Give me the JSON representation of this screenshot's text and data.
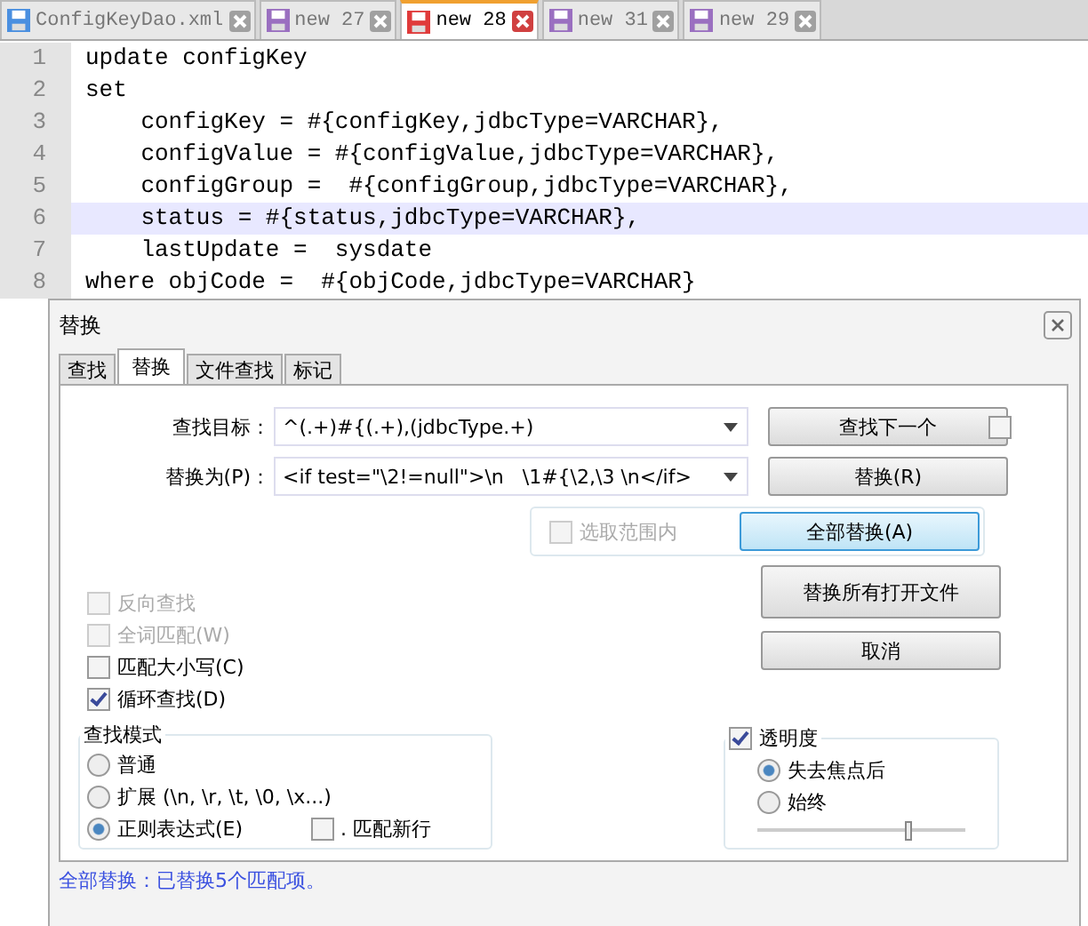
{
  "file_tabs": [
    {
      "label": "ConfigKeyDao.xml",
      "selected": false,
      "color": "#4a8fe0"
    },
    {
      "label": "new 27",
      "selected": false,
      "color": "#9a6fc0"
    },
    {
      "label": "new 28",
      "selected": true,
      "color": "#e03a3a"
    },
    {
      "label": "new 31",
      "selected": false,
      "color": "#9a6fc0"
    },
    {
      "label": "new 29",
      "selected": false,
      "color": "#9a6fc0"
    }
  ],
  "editor": {
    "lines": [
      {
        "number": "1",
        "text": "update configKey",
        "current": false
      },
      {
        "number": "2",
        "text": "set",
        "current": false
      },
      {
        "number": "3",
        "text": "    configKey = #{configKey,jdbcType=VARCHAR},",
        "current": false
      },
      {
        "number": "4",
        "text": "    configValue = #{configValue,jdbcType=VARCHAR},",
        "current": false
      },
      {
        "number": "5",
        "text": "    configGroup =  #{configGroup,jdbcType=VARCHAR},",
        "current": false
      },
      {
        "number": "6",
        "text": "    status = #{status,jdbcType=VARCHAR},",
        "current": true
      },
      {
        "number": "7",
        "text": "    lastUpdate =  sysdate",
        "current": false
      },
      {
        "number": "8",
        "text": "where objCode =  #{objCode,jdbcType=VARCHAR}",
        "current": false
      }
    ]
  },
  "dialog": {
    "title": "替换",
    "tabs": [
      {
        "label": "查找",
        "selected": false
      },
      {
        "label": "替换",
        "selected": true
      },
      {
        "label": "文件查找",
        "selected": false
      },
      {
        "label": "标记",
        "selected": false
      }
    ],
    "find": {
      "label": "查找目标：",
      "value": "^(.+)#{(.+),(jdbcType.+)"
    },
    "replace": {
      "label": "替换为(P)：",
      "value": "<if test=\"\\2!=null\">\\n   \\1#{\\2,\\3 \\n</if>"
    },
    "find_next_checkbox": {
      "checked": false
    },
    "in_selection": {
      "label": "选取范围内",
      "checked": false,
      "disabled": true
    },
    "buttons": [
      {
        "label": "查找下一个",
        "focused": false
      },
      {
        "label": "替换(R)",
        "focused": false
      },
      {
        "label": "全部替换(A)",
        "focused": true
      },
      {
        "label": "替换所有打开文件",
        "focused": false
      },
      {
        "label": "取消",
        "focused": false
      }
    ],
    "options": [
      {
        "label": "反向查找",
        "checked": false,
        "disabled": true
      },
      {
        "label": "全词匹配(W)",
        "checked": false,
        "disabled": true
      },
      {
        "label": "匹配大小写(C)",
        "checked": false,
        "disabled": false
      },
      {
        "label": "循环查找(D)",
        "checked": true,
        "disabled": false
      }
    ],
    "search_mode": {
      "title": "查找模式",
      "modes": [
        {
          "label": "普通",
          "selected": false
        },
        {
          "label": "扩展 (\\n, \\r, \\t, \\0, \\x...)",
          "selected": false
        },
        {
          "label": "正则表达式(E)",
          "selected": true
        }
      ],
      "dot_newline": {
        "label": ". 匹配新行",
        "checked": false
      }
    },
    "transparency": {
      "title": "透明度",
      "checked": true,
      "modes": [
        {
          "label": "失去焦点后",
          "selected": true
        },
        {
          "label": "始终",
          "selected": false
        }
      ],
      "level": 0.73
    },
    "status": "全部替换：已替换5个匹配项。"
  }
}
